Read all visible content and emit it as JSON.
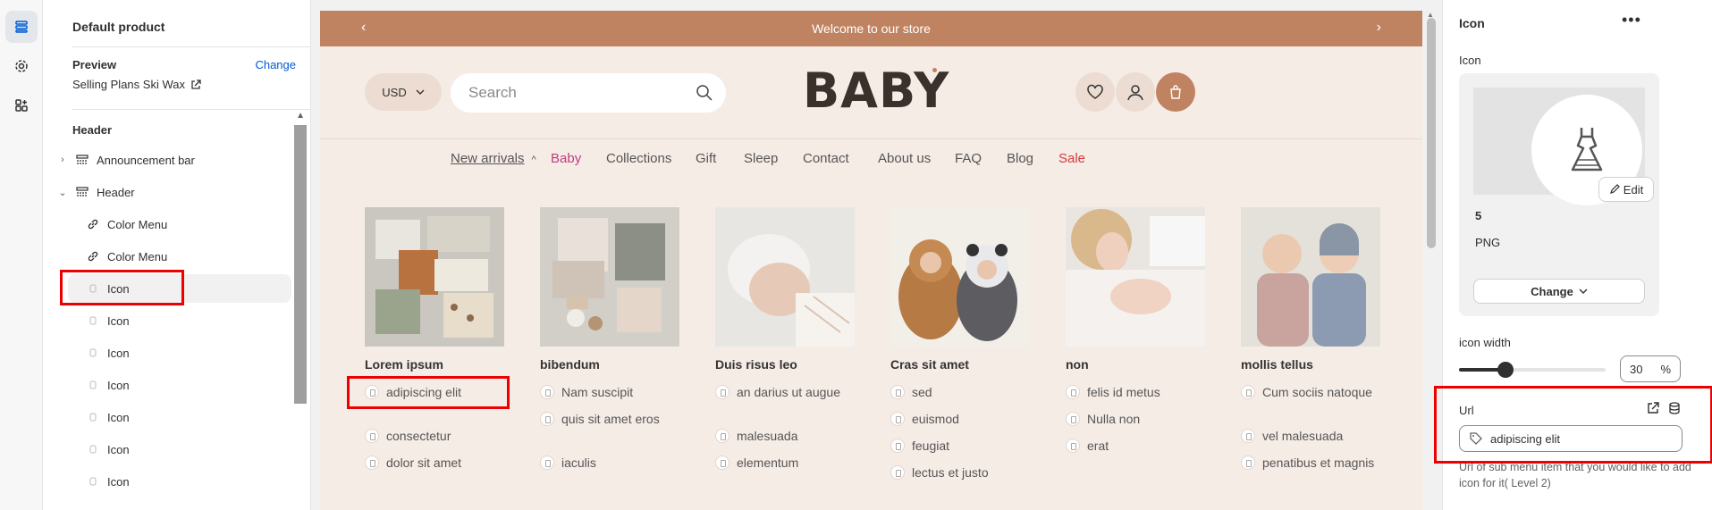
{
  "tree": {
    "title": "Default product",
    "preview_label": "Preview",
    "change_label": "Change",
    "preview_value": "Selling Plans Ski Wax",
    "section_label": "Header",
    "rows": [
      {
        "label": "Announcement bar",
        "level": 0,
        "expand": "collapsed",
        "icon": "section-icon"
      },
      {
        "label": "Header",
        "level": 0,
        "expand": "expanded",
        "icon": "section-icon"
      },
      {
        "label": "Color Menu",
        "level": 1,
        "icon": "link-icon"
      },
      {
        "label": "Color Menu",
        "level": 1,
        "icon": "link-icon"
      },
      {
        "label": "Icon",
        "level": 1,
        "icon": "image-icon",
        "selected": true
      },
      {
        "label": "Icon",
        "level": 1,
        "icon": "image-icon"
      },
      {
        "label": "Icon",
        "level": 1,
        "icon": "image-icon"
      },
      {
        "label": "Icon",
        "level": 1,
        "icon": "image-icon"
      },
      {
        "label": "Icon",
        "level": 1,
        "icon": "image-icon"
      },
      {
        "label": "Icon",
        "level": 1,
        "icon": "image-icon"
      },
      {
        "label": "Icon",
        "level": 1,
        "icon": "image-icon"
      }
    ]
  },
  "store": {
    "announcement": "Welcome to our store",
    "currency": "USD",
    "search_placeholder": "Search",
    "logo": "BABY",
    "nav": [
      {
        "label": "New arrivals",
        "style": "underline",
        "has_caret": true
      },
      {
        "label": "Baby",
        "style": "pink"
      },
      {
        "label": "Collections",
        "style": "normal"
      },
      {
        "label": "Gift",
        "style": "normal"
      },
      {
        "label": "Sleep",
        "style": "normal"
      },
      {
        "label": "Contact",
        "style": "normal"
      },
      {
        "label": "About us",
        "style": "normal"
      },
      {
        "label": "FAQ",
        "style": "normal"
      },
      {
        "label": "Blog",
        "style": "normal"
      },
      {
        "label": "Sale",
        "style": "red"
      }
    ],
    "columns": [
      {
        "heading": "Lorem ipsum",
        "image": "baby-clothes-flatlay",
        "items": [
          "adipiscing elit",
          "consectetur",
          "dolor sit amet"
        ]
      },
      {
        "heading": "bibendum",
        "image": "baby-outfit-flatlay",
        "items": [
          "Nam suscipit",
          "quis sit amet eros",
          "iaculis"
        ]
      },
      {
        "heading": "Duis risus leo",
        "image": "sleeping-baby",
        "items": [
          "an darius ut augue",
          "malesuada",
          "elementum"
        ]
      },
      {
        "heading": "Cras sit amet",
        "image": "babies-in-animal-costumes",
        "items": [
          "sed",
          "euismod",
          "feugiat",
          "lectus et justo"
        ]
      },
      {
        "heading": "non",
        "image": "mother-with-newborn",
        "items": [
          "felis id metus",
          "Nulla non",
          "erat"
        ]
      },
      {
        "heading": "mollis tellus",
        "image": "two-toddlers",
        "items": [
          "Cum sociis natoque",
          "vel malesuada",
          "penatibus et magnis"
        ]
      }
    ]
  },
  "panel": {
    "title": "Icon",
    "more": "•••",
    "icon_label": "Icon",
    "edit_label": "Edit",
    "image_name": "5",
    "image_format": "PNG",
    "change_label": "Change",
    "width_label": "icon width",
    "width_value": "30",
    "width_unit": "%",
    "width_fraction": 0.3,
    "url_label": "Url",
    "url_value": "adipiscing elit",
    "help_text": "Url of sub menu item that you would like to add icon for it( Level 2)"
  },
  "colors": {
    "announcement_bg": "#c08362",
    "store_bg": "#f6ece6",
    "accent_pink": "#c23c80",
    "sale_red": "#d23b3b",
    "link_blue": "#005bd3",
    "highlight": "#ee0000"
  }
}
